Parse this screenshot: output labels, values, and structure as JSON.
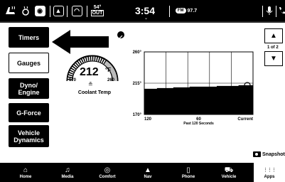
{
  "status": {
    "temp_value": "54°",
    "temp_label": "OUT",
    "time": "3:54",
    "radio_badge": "FM",
    "radio_freq": "97.7"
  },
  "menu": [
    {
      "label": "Timers",
      "selected": false
    },
    {
      "label": "Gauges",
      "selected": true
    },
    {
      "label": "Dyno/ Engine",
      "selected": false
    },
    {
      "label": "G-Force",
      "selected": false
    },
    {
      "label": "Vehicle Dynamics",
      "selected": false
    }
  ],
  "gauge": {
    "value": "212",
    "unit": "°F",
    "min": "170",
    "max": "260",
    "label": "Coolant Temp"
  },
  "chart_data": {
    "type": "area",
    "x_ticks": [
      "120",
      "60",
      "Current"
    ],
    "xlabel": "Past 120 Seconds",
    "y_ticks": [
      "260°",
      "215°",
      "170°"
    ],
    "ylim": [
      170,
      260
    ],
    "x": [
      120,
      114,
      110,
      106,
      100,
      94,
      88,
      82,
      76,
      70,
      64,
      58,
      52,
      46,
      40,
      34,
      28,
      22,
      16,
      10,
      4,
      0
    ],
    "values": [
      207,
      207,
      207,
      208,
      208,
      208,
      209,
      209,
      209,
      210,
      210,
      210,
      210,
      210,
      211,
      211,
      211,
      211,
      212,
      212,
      212,
      212
    ],
    "grid": true
  },
  "pager": {
    "text": "1 of 2"
  },
  "snapshot": {
    "label": "Snapshot"
  },
  "nav": [
    {
      "label": "Home",
      "icon": "home-icon",
      "glyph": "⌂"
    },
    {
      "label": "Media",
      "icon": "music-icon",
      "glyph": "♫"
    },
    {
      "label": "Comfort",
      "icon": "comfort-icon",
      "glyph": "◎"
    },
    {
      "label": "Nav",
      "icon": "nav-icon",
      "glyph": "▲"
    },
    {
      "label": "Phone",
      "icon": "phone-icon",
      "glyph": "▯"
    },
    {
      "label": "Vehicle",
      "icon": "car-icon",
      "glyph": "⛟"
    },
    {
      "label": "Apps",
      "icon": "apps-icon",
      "glyph": "⋮⋮⋮"
    }
  ]
}
